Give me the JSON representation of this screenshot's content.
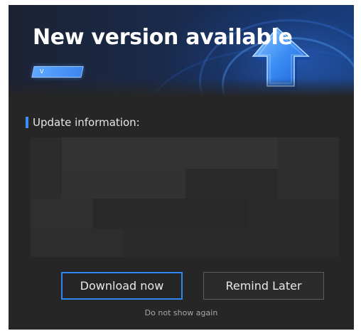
{
  "dialog": {
    "title": "New version available",
    "version_badge": "V",
    "section_heading": "Update information:",
    "buttons": {
      "download": "Download now",
      "remind": "Remind Later"
    },
    "dont_show_again": "Do not show again"
  },
  "colors": {
    "background": "#262626",
    "accent": "#2f86f0",
    "marker": "#3a8ef6",
    "text": "#e6e6e6",
    "muted_text": "#a8a8a8"
  },
  "icons": [
    "upload-arrow-icon"
  ]
}
